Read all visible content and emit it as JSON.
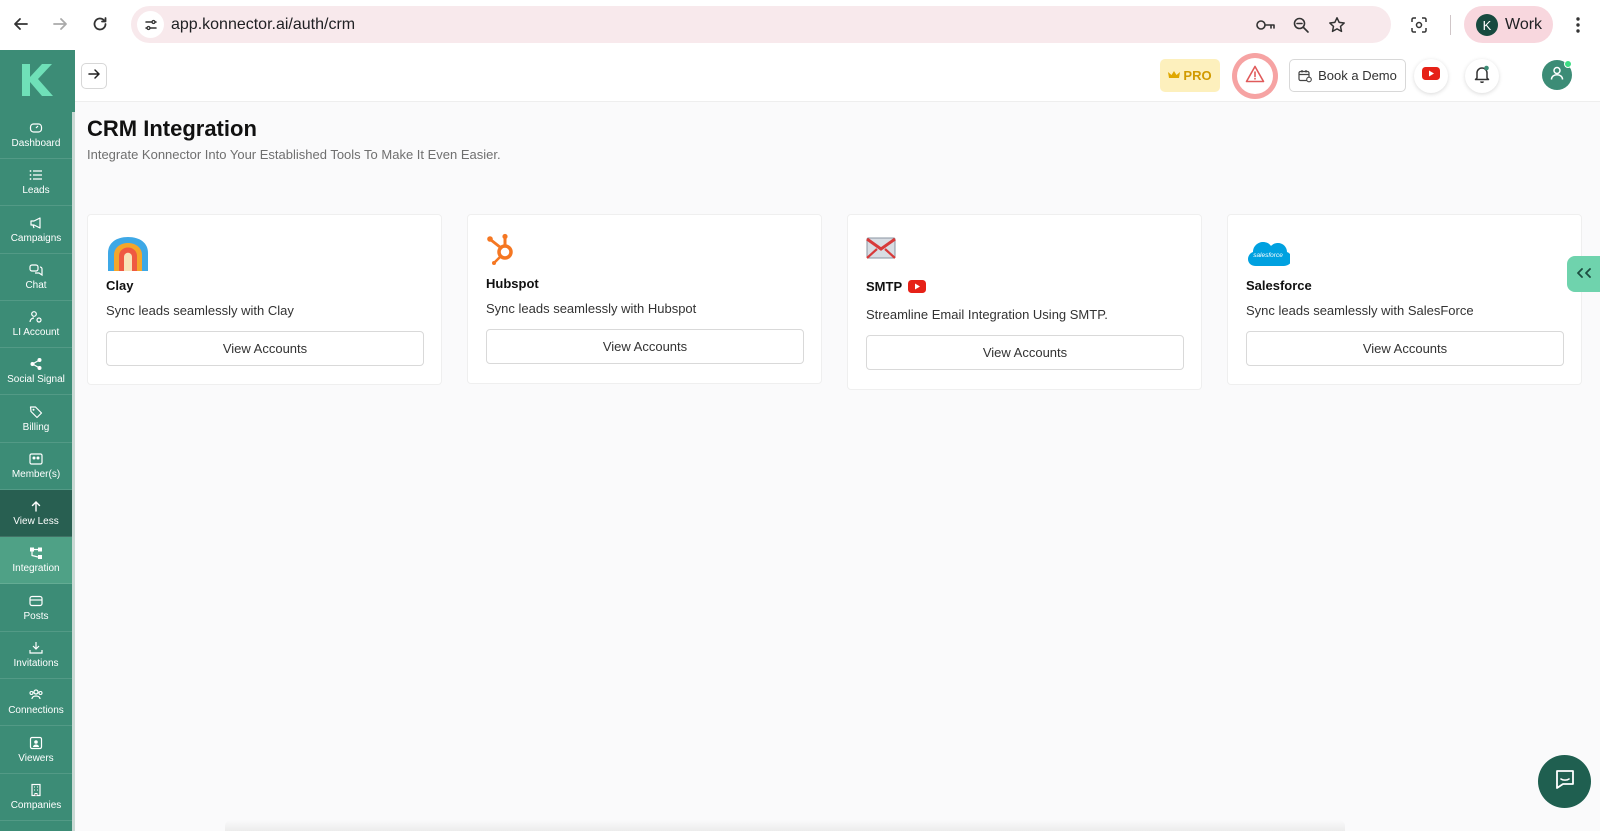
{
  "browser": {
    "url": "app.konnector.ai/auth/crm",
    "profile_initial": "K",
    "profile_name": "Work",
    "icons": [
      "back-arrow-icon",
      "forward-arrow-icon",
      "reload-icon",
      "site-info-icon",
      "password-key-icon",
      "zoom-icon",
      "bookmark-star-icon",
      "screenshot-icon",
      "more-vert-icon"
    ]
  },
  "sidebar": {
    "logo": "K",
    "items": [
      {
        "label": "Dashboard",
        "icon": "dashboard-icon"
      },
      {
        "label": "Leads",
        "icon": "list-icon"
      },
      {
        "label": "Campaigns",
        "icon": "megaphone-icon"
      },
      {
        "label": "Chat",
        "icon": "chat-icon"
      },
      {
        "label": "LI Account",
        "icon": "user-settings-icon"
      },
      {
        "label": "Social Signal",
        "icon": "share-icon"
      },
      {
        "label": "Billing",
        "icon": "tag-icon"
      },
      {
        "label": "Member(s)",
        "icon": "members-icon"
      },
      {
        "label": "View Less",
        "icon": "arrow-up-icon"
      },
      {
        "label": "Integration",
        "icon": "integration-icon"
      },
      {
        "label": "Posts",
        "icon": "posts-icon"
      },
      {
        "label": "Invitations",
        "icon": "invitations-icon"
      },
      {
        "label": "Connections",
        "icon": "connections-icon"
      },
      {
        "label": "Viewers",
        "icon": "viewers-icon"
      },
      {
        "label": "Companies",
        "icon": "companies-icon"
      }
    ]
  },
  "topbar": {
    "pro_label": "PRO",
    "demo_label": "Book a Demo"
  },
  "page": {
    "title": "CRM Integration",
    "subtitle": "Integrate Konnector Into Your Established Tools To Make It Even Easier."
  },
  "cards": [
    {
      "name": "Clay",
      "description": "Sync leads seamlessly with Clay",
      "button": "View Accounts"
    },
    {
      "name": "Hubspot",
      "description": "Sync leads seamlessly with Hubspot",
      "button": "View Accounts"
    },
    {
      "name": "SMTP",
      "description": "Streamline Email Integration Using SMTP.",
      "button": "View Accounts"
    },
    {
      "name": "Salesforce",
      "logo_text": "salesforce",
      "description": "Sync leads seamlessly with SalesForce",
      "button": "View Accounts"
    }
  ],
  "colors": {
    "brand_green": "#3c8c76",
    "sidebar_active": "#4fa186",
    "sidebar_dark": "#285f51",
    "pro_bg": "#fdf0bd",
    "pro_text": "#d19a00",
    "warning_red": "#e05a5a",
    "hubspot_orange": "#f57722",
    "salesforce_blue": "#00a1e0",
    "youtube_red": "#e62117"
  }
}
